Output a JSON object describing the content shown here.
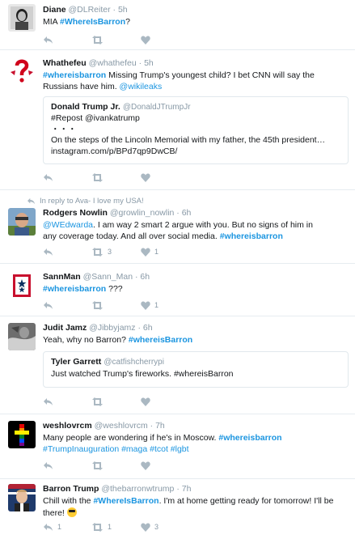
{
  "tweets": [
    {
      "name": "Diane",
      "handle": "@DLReiter",
      "time": "5h",
      "text_plain": "MIA ",
      "text_tag": "#WhereIsBarron",
      "text_tail": "?"
    },
    {
      "name": "Whathefeu",
      "handle": "@whathefeu",
      "time": "5h",
      "line1_tag": "#whereisbarron",
      "line1_text": " Missing Trump's youngest child?  I bet CNN will say the",
      "line2_text": "Russians have him. ",
      "line2_mention": "@wikileaks",
      "quote": {
        "name": "Donald Trump Jr.",
        "handle": "@DonaldJTrumpJr",
        "line1": "#Repost @ivankatrump",
        "line2": "・・・",
        "line3": "On the steps of the Lincoln Memorial with my father, the 45th president…",
        "line4": "instagram.com/p/BPd7qp9DwCB/"
      }
    },
    {
      "context": "In reply to Ava- I love my USA!",
      "name": "Rodgers Nowlin",
      "handle": "@growlin_nowlin",
      "time": "6h",
      "mention": "@WEdwarda",
      "line1_text": ".  I am way 2 smart 2 argue with you.   But no signs of him in",
      "line2_text": "any coverage today.  And all over social media. ",
      "line2_tag": "#whereisbarron",
      "retweets": "3",
      "likes": "1"
    },
    {
      "name": "SannMan",
      "handle": "@Sann_Man",
      "time": "6h",
      "text_tag": "#whereisbarron",
      "text_tail": " ???",
      "likes": "1"
    },
    {
      "name": "Judit Jamz",
      "handle": "@Jibbyjamz",
      "time": "6h",
      "text_plain": "Yeah, why no Barron? ",
      "text_tag": "#whereisBarron",
      "quote": {
        "name": "Tyler Garrett",
        "handle": "@catfishcherrypi",
        "line1": "Just watched Trump's fireworks. #whereisBarron"
      }
    },
    {
      "name": "weshlovrcm",
      "handle": "@weshlovrcm",
      "time": "7h",
      "line1_text": "Many people are wondering if he's in Moscow. ",
      "line1_tag": "#whereisbarron",
      "line2_tags": "#TrumpInauguration  #maga #tcot #lgbt"
    },
    {
      "name": "Barron Trump",
      "handle": "@thebarronwtrump",
      "time": "7h",
      "line1_text": "Chill with the ",
      "line1_tag": "#WhereIsBarron",
      "line1_tail": ". I'm at home getting ready for tomorrow! I'll be",
      "line2_text": "there! ",
      "replies": "1",
      "retweets": "1",
      "likes": "3"
    }
  ],
  "colors": {
    "link": "#1b95e0",
    "meta": "#8899a6",
    "icon": "#aab8c2",
    "border": "#e6ecf0"
  },
  "icons": [
    "reply-icon",
    "retweet-icon",
    "like-icon",
    "in-reply-arrow-icon",
    "sunglasses-emoji-icon"
  ]
}
